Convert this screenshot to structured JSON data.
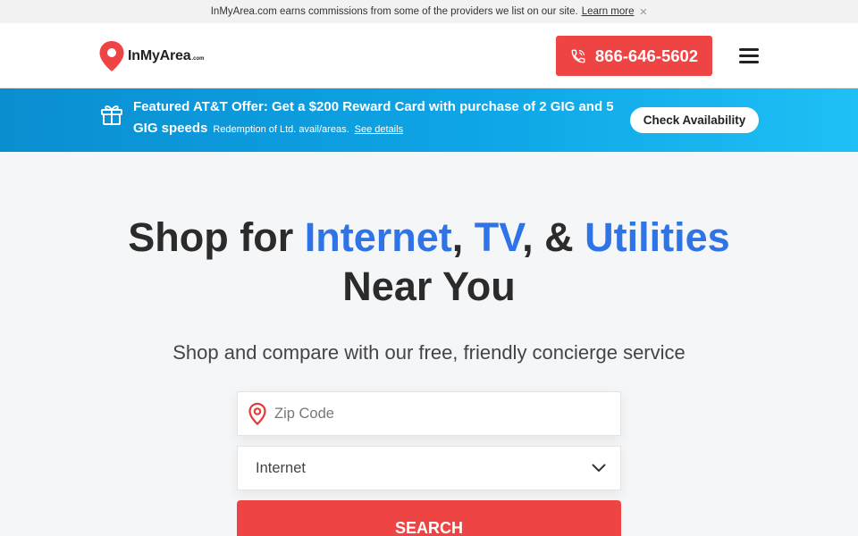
{
  "disclosure": {
    "text": "InMyArea.com earns commissions from some of the providers we list on our site.",
    "link": "Learn more",
    "close": "×"
  },
  "header": {
    "logo_text": "InMyArea",
    "logo_suffix": ".com",
    "phone": "866-646-5602",
    "menu_icon": "hamburger-menu-icon"
  },
  "promo": {
    "icon": "gift-icon",
    "headline": "Featured AT&T Offer: Get a $200 Reward Card with purchase of 2 GIG and 5 GIG speeds",
    "fine_print": "Redemption of Ltd. avail/areas.",
    "details_link": "See details",
    "cta": "Check Availability"
  },
  "hero": {
    "title_1": "Shop for ",
    "title_internet": "Internet",
    "title_sep1": ", ",
    "title_tv": "TV",
    "title_sep2": ", & ",
    "title_utilities": "Utilities",
    "title_2": "Near You",
    "subtitle": "Shop and compare with our free, friendly concierge service"
  },
  "search": {
    "zip_placeholder": "Zip Code",
    "zip_value": "",
    "service_selected": "Internet",
    "button": "SEARCH"
  },
  "colors": {
    "accent_red": "#ef4444",
    "accent_blue": "#2f74e6",
    "promo_blue": "#0ea5e6"
  }
}
